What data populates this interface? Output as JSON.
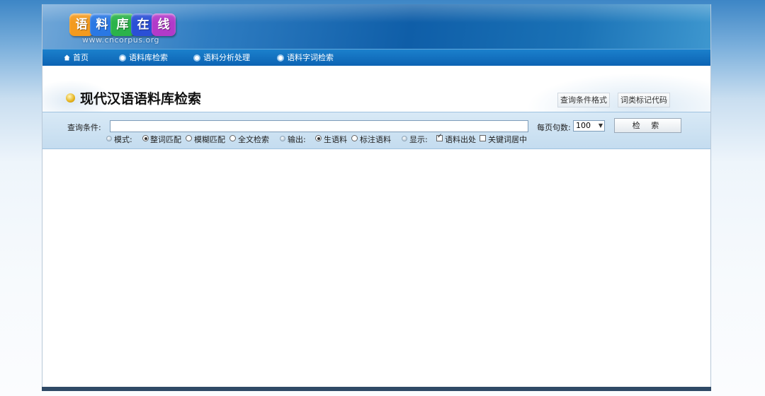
{
  "logo": {
    "tiles": [
      {
        "char": "语",
        "color": "#f39a1e"
      },
      {
        "char": "料",
        "color": "#2a78e4"
      },
      {
        "char": "库",
        "color": "#2bb34a"
      },
      {
        "char": "在",
        "color": "#2a4fd6"
      },
      {
        "char": "线",
        "color": "#b23ac9"
      }
    ],
    "url": "www.cncorpus.org"
  },
  "nav": {
    "home": "首页",
    "items": [
      "语料库检索",
      "语料分析处理",
      "语料字词检索"
    ]
  },
  "title": {
    "text": "现代汉语语料库检索",
    "buttons": [
      "查询条件格式",
      "词类标记代码"
    ]
  },
  "search": {
    "query_label": "查询条件:",
    "query_value": "",
    "per_page_label": "每页句数:",
    "per_page_value": "100",
    "search_button": "检 索",
    "mode": {
      "label": "模式:",
      "options": [
        "整词匹配",
        "模糊匹配",
        "全文检索"
      ],
      "selected": 0
    },
    "output": {
      "label": "输出:",
      "options": [
        "生语料",
        "标注语料"
      ],
      "selected": 0
    },
    "display": {
      "label": "显示:",
      "options": [
        {
          "label": "语料出处",
          "checked": true
        },
        {
          "label": "关键词居中",
          "checked": false
        }
      ]
    }
  },
  "colors": {
    "banner": "#0f5ea8",
    "nav": "#1b80cc",
    "search_bar": "#c4dcef"
  }
}
